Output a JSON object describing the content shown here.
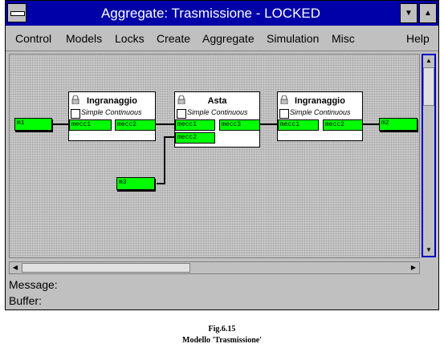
{
  "window": {
    "title": "Aggregate: Trasmissione - LOCKED"
  },
  "menu": [
    "Control",
    "Models",
    "Locks",
    "Create",
    "Aggregate",
    "Simulation",
    "Misc",
    "Help"
  ],
  "blocks": [
    {
      "title": "Ingranaggio",
      "subtitle": "Simple Continuous",
      "ports": [
        "mecc1",
        "mecc2"
      ]
    },
    {
      "title": "Asta",
      "subtitle": "Simple Continuous",
      "ports": [
        "mecc1",
        "mecc3",
        "mecc2"
      ]
    },
    {
      "title": "Ingranaggio",
      "subtitle": "Simple Continuous",
      "ports": [
        "mecc1",
        "mecc2"
      ]
    }
  ],
  "external_ports": [
    "m1",
    "m2",
    "m3"
  ],
  "status": {
    "message_label": "Message:",
    "buffer_label": "Buffer:"
  },
  "caption": {
    "line1": "Fig.6.15",
    "line2": "Modello 'Trasmissione'"
  },
  "colors": {
    "titlebar": "#0000a8",
    "port": "#00ff00",
    "scroll_focus": "#0000c8"
  }
}
